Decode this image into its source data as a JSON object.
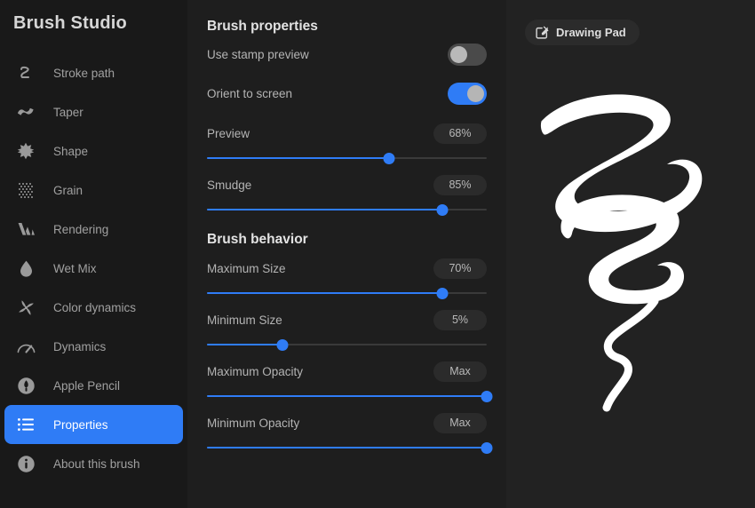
{
  "app": {
    "title": "Brush Studio",
    "accent_color": "#2f7cf6",
    "sidebar_bg": "#191919",
    "panel_bg": "#1e1e1e",
    "canvas_bg": "#222222"
  },
  "sidebar": {
    "items": [
      {
        "label": "Stroke path",
        "icon": "stroke-path-icon",
        "active": false
      },
      {
        "label": "Taper",
        "icon": "taper-icon",
        "active": false
      },
      {
        "label": "Shape",
        "icon": "shape-icon",
        "active": false
      },
      {
        "label": "Grain",
        "icon": "grain-icon",
        "active": false
      },
      {
        "label": "Rendering",
        "icon": "rendering-icon",
        "active": false
      },
      {
        "label": "Wet Mix",
        "icon": "wet-mix-icon",
        "active": false
      },
      {
        "label": "Color dynamics",
        "icon": "color-dynamics-icon",
        "active": false
      },
      {
        "label": "Dynamics",
        "icon": "dynamics-icon",
        "active": false
      },
      {
        "label": "Apple Pencil",
        "icon": "apple-pencil-icon",
        "active": false
      },
      {
        "label": "Properties",
        "icon": "properties-list-icon",
        "active": true
      },
      {
        "label": "About this brush",
        "icon": "info-icon",
        "active": false
      }
    ]
  },
  "properties_panel": {
    "section_one_title": "Brush properties",
    "section_two_title": "Brush behavior",
    "switches": [
      {
        "label": "Use stamp preview",
        "state": "off"
      },
      {
        "label": "Orient to screen",
        "state": "on"
      }
    ],
    "sliders_properties": [
      {
        "label": "Preview",
        "value_label": "68%",
        "fill_percent": 65
      },
      {
        "label": "Smudge",
        "value_label": "85%",
        "fill_percent": 84
      }
    ],
    "sliders_behavior": [
      {
        "label": "Maximum Size",
        "value_label": "70%",
        "fill_percent": 84
      },
      {
        "label": "Minimum Size",
        "value_label": "5%",
        "fill_percent": 27
      },
      {
        "label": "Maximum Opacity",
        "value_label": "Max",
        "fill_percent": 100
      },
      {
        "label": "Minimum Opacity",
        "value_label": "Max",
        "fill_percent": 100
      }
    ]
  },
  "canvas": {
    "pad_button_label": "Drawing Pad",
    "pad_button_icon": "edit-square-icon",
    "stroke_color": "#ffffff",
    "stroke_description": "tapered serpentine brush stroke preview"
  }
}
